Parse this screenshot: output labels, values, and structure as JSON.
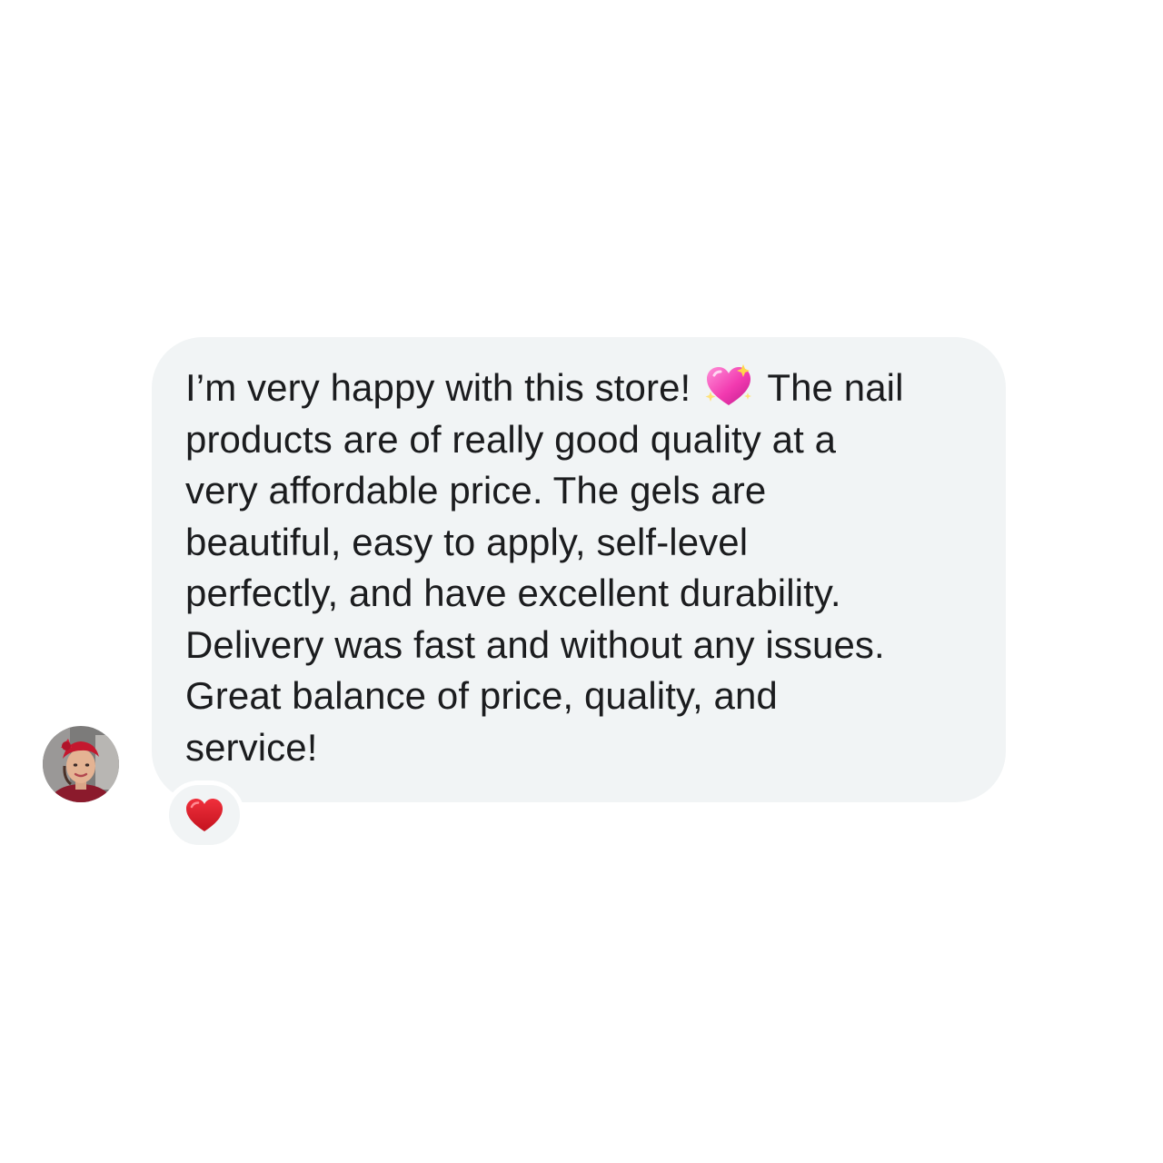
{
  "message": {
    "lines": [
      {
        "before": "I’m very happy with this store!",
        "after": "The nail"
      },
      "products are of really good quality at a",
      "very affordable price. The gels are",
      "beautiful, easy to apply, self-level",
      "perfectly, and have excellent durability.",
      "Delivery was fast and without any issues.",
      "Great balance of price, quality, and",
      "service!"
    ],
    "inline_emoji": "sparkling-heart-icon",
    "bubble_color": "#f1f4f5",
    "text_color": "#1b1c1e"
  },
  "sender": {
    "avatar_icon": "avatar"
  },
  "reaction": {
    "emoji": "heart-icon",
    "color": "#e0202e"
  }
}
